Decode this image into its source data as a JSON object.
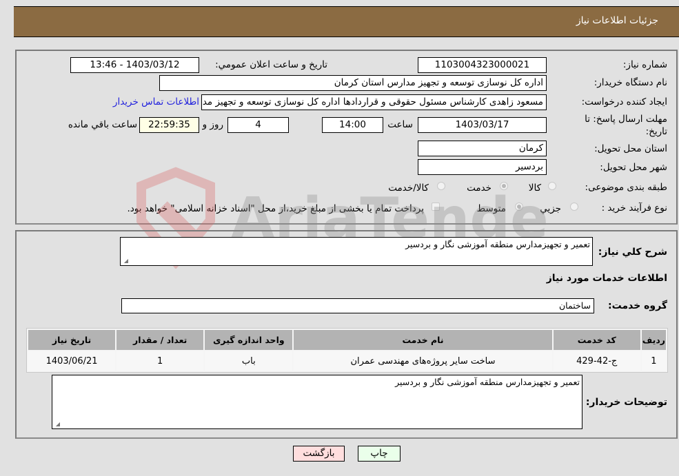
{
  "header": {
    "title": "جزئیات اطلاعات نیاز"
  },
  "form": {
    "need_number": {
      "label": "شماره نیاز:",
      "value": "1103004323000021"
    },
    "announce_datetime": {
      "label": "تاریخ و ساعت اعلان عمومي:",
      "value": "1403/03/12 - 13:46"
    },
    "buyer_org": {
      "label": "نام دستگاه خريدار:",
      "value": "اداره کل نوسازی  توسعه و تجهیز مدارس استان کرمان"
    },
    "requester": {
      "label": "ایجاد کننده درخواست:",
      "value": "مسعود زاهدی کارشناس مسئول حقوقی و قراردادها اداره کل نوسازی  توسعه و تجهیز مدارس استان کرمان"
    },
    "buyer_contact_link": "اطلاعات تماس خریدار",
    "deadline": {
      "label": "مهلت ارسال پاسخ: تا تاریخ:",
      "date": "1403/03/17",
      "time_label": "ساعت",
      "time": "14:00",
      "days": "4",
      "days_label": "روز و",
      "remaining": "22:59:35",
      "remaining_label": "ساعت باقي مانده"
    },
    "province": {
      "label": "استان محل تحویل:",
      "value": "کرمان"
    },
    "city": {
      "label": "شهر محل تحویل:",
      "value": "بردسیر"
    },
    "category": {
      "label": "طبقه بندی موضوعی:",
      "options": [
        {
          "label": "کالا",
          "checked": false
        },
        {
          "label": "خدمت",
          "checked": true
        },
        {
          "label": "کالا/خدمت",
          "checked": false
        }
      ]
    },
    "purchase_process": {
      "label": "نوع فرآیند خرید :",
      "options": [
        {
          "label": "جزيي",
          "checked": false
        },
        {
          "label": "متوسط",
          "checked": true
        }
      ],
      "treasury_checkbox": {
        "label": "پرداخت تمام یا بخشی از مبلغ خرید،از محل \"اسناد خزانه اسلامی\" خواهد بود.",
        "checked": false
      }
    }
  },
  "details": {
    "general_desc": {
      "label": "شرح کلي نياز:",
      "value": "تعمیر و تجهیزمدارس  منطقه آموزشی نگار و  بردسیر"
    },
    "services_title": "اطلاعات خدمات مورد نیاز",
    "service_group": {
      "label": "گروه خدمت:",
      "value": "ساختمان"
    },
    "table": {
      "headers": [
        "ردیف",
        "کد خدمت",
        "نام خدمت",
        "واحد اندازه گیری",
        "تعداد / مقدار",
        "تاریخ نیاز"
      ],
      "rows": [
        [
          "1",
          "ج-42-429",
          "ساخت سایر پروژه‌های مهندسی عمران",
          "باب",
          "1",
          "1403/06/21"
        ]
      ]
    },
    "buyer_notes": {
      "label": "توضیحات خریدار:",
      "value": "تعمیر و تجهیزمدارس  منطقه آموزشی نگار و  بردسیر"
    }
  },
  "buttons": {
    "print": "چاپ",
    "back": "بازگشت"
  },
  "colors": {
    "header_bg": "#8b6b42",
    "print_bg": "#eaffea",
    "back_bg": "#ffdede",
    "link": "#2222dd"
  },
  "watermark": "AriaTender.neT"
}
